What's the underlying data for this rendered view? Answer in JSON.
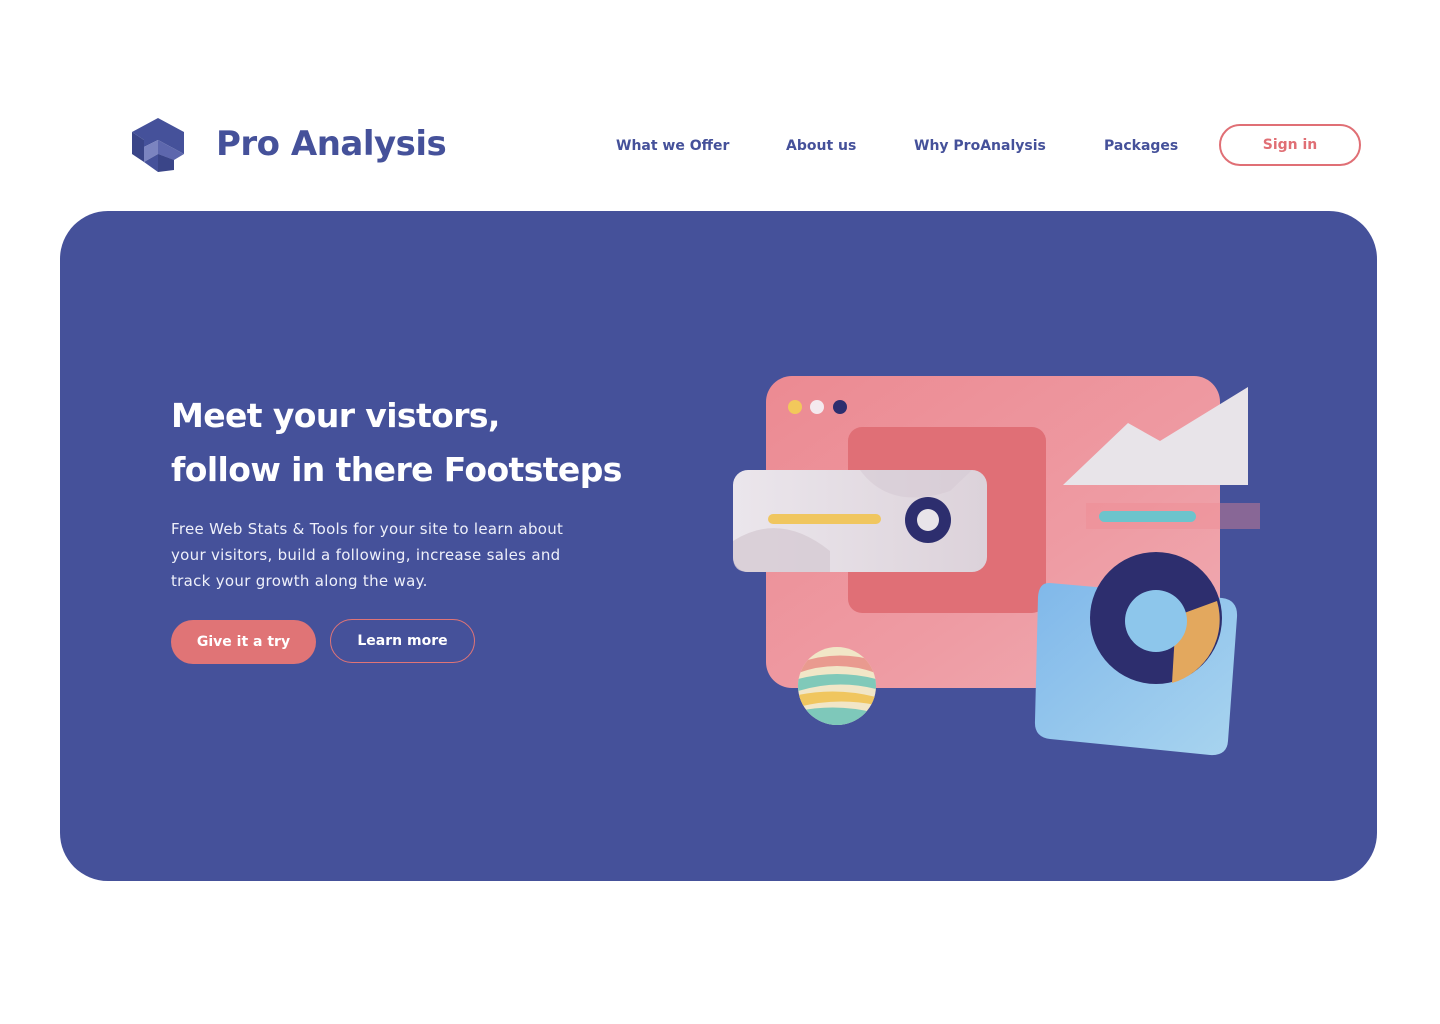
{
  "brand": {
    "name": "Pro Analysis",
    "logo_icon": "cube-logo-icon",
    "color": "#45519a"
  },
  "nav": {
    "items": [
      {
        "label": "What we Offer"
      },
      {
        "label": "About us"
      },
      {
        "label": "Why ProAnalysis"
      },
      {
        "label": "Packages"
      }
    ],
    "signin_label": "Sign in"
  },
  "hero": {
    "headline_line1": "Meet your vistors,",
    "headline_line2": "follow in there Footsteps",
    "description": "Free Web Stats & Tools for  your site to learn about your visitors, build a following, increase sales and track your growth along the way.",
    "primary_button": "Give it a try",
    "secondary_button": "Learn more",
    "illustration": "analytics-dashboard-illustration"
  },
  "colors": {
    "primary": "#45519a",
    "accent": "#e06f75",
    "background": "#ffffff"
  }
}
